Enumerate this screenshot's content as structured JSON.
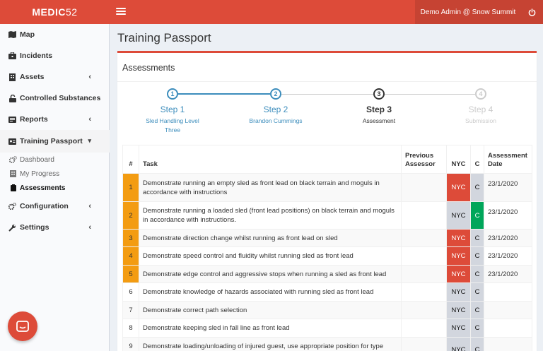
{
  "app": {
    "logo_bold": "MEDIC",
    "logo_light": "52",
    "user": "Demo Admin @ Snow Summit"
  },
  "sidebar": {
    "items": [
      {
        "label": "Map",
        "icon": "map-icon"
      },
      {
        "label": "Incidents",
        "icon": "briefcase-icon"
      },
      {
        "label": "Assets",
        "icon": "building-icon"
      },
      {
        "label": "Controlled Substances",
        "icon": "lock-icon"
      },
      {
        "label": "Reports",
        "icon": "report-icon"
      },
      {
        "label": "Training Passport",
        "icon": "passport-icon"
      },
      {
        "label": "Configuration",
        "icon": "gears-icon"
      },
      {
        "label": "Settings",
        "icon": "wrench-icon"
      }
    ],
    "sub_items": [
      {
        "label": "Dashboard",
        "icon": "gears-icon"
      },
      {
        "label": "My Progress",
        "icon": "building-icon"
      },
      {
        "label": "Assessments",
        "icon": "clipboard-icon"
      }
    ]
  },
  "page": {
    "title": "Training Passport"
  },
  "box": {
    "title": "Assessments"
  },
  "steps": [
    {
      "number": "1",
      "title": "Step 1",
      "sub1": "Sled Handling Level",
      "sub2": "Three",
      "state": "done"
    },
    {
      "number": "2",
      "title": "Step 2",
      "sub1": "Brandon Cummings",
      "sub2": "",
      "state": "done"
    },
    {
      "number": "3",
      "title": "Step 3",
      "sub1": "Assessment",
      "sub2": "",
      "state": "current"
    },
    {
      "number": "4",
      "title": "Step 4",
      "sub1": "Submission",
      "sub2": "",
      "state": "todo"
    }
  ],
  "table": {
    "headers": {
      "num": "#",
      "task": "Task",
      "prev1": "Previous",
      "prev2": "Assessor",
      "nyc": "NYC",
      "c": "C",
      "date1": "Assessment",
      "date2": "Date"
    },
    "rows": [
      {
        "num": "1",
        "task": "Demonstrate running an empty sled as front lead on black terrain and moguls in accordance with instructions",
        "nyc": "NYC",
        "c": "C",
        "date": "23/1/2020",
        "flag": true,
        "result": "nyc"
      },
      {
        "num": "2",
        "task": "Demonstrate running a loaded sled (front lead positions) on black terrain and moguls in accordance with instructions.",
        "nyc": "NYC",
        "c": "C",
        "date": "23/1/2020",
        "flag": true,
        "result": "c"
      },
      {
        "num": "3",
        "task": "Demonstrate direction change whilst running as front lead on sled",
        "nyc": "NYC",
        "c": "C",
        "date": "23/1/2020",
        "flag": true,
        "result": "nyc"
      },
      {
        "num": "4",
        "task": "Demonstrate speed control and fluidity whilst running sled as front lead",
        "nyc": "NYC",
        "c": "C",
        "date": "23/1/2020",
        "flag": true,
        "result": "nyc"
      },
      {
        "num": "5",
        "task": "Demonstrate edge control and aggressive stops when running a sled as front lead",
        "nyc": "NYC",
        "c": "C",
        "date": "23/1/2020",
        "flag": true,
        "result": "nyc"
      },
      {
        "num": "6",
        "task": "Demonstrate knowledge of hazards associated with running sled as front lead",
        "nyc": "NYC",
        "c": "C",
        "date": "",
        "flag": false,
        "result": ""
      },
      {
        "num": "7",
        "task": "Demonstrate correct path selection",
        "nyc": "NYC",
        "c": "C",
        "date": "",
        "flag": false,
        "result": ""
      },
      {
        "num": "8",
        "task": "Demonstrate keeping sled in fall line as front lead",
        "nyc": "NYC",
        "c": "C",
        "date": "",
        "flag": false,
        "result": ""
      },
      {
        "num": "9",
        "task": "Demonstrate loading/unloading of injured guest, use appropriate position for type",
        "nyc": "NYC",
        "c": "C",
        "date": "",
        "flag": false,
        "result": ""
      }
    ]
  },
  "colors": {
    "brand": "#dd4b39",
    "step_done": "#3c8dbc",
    "flag": "#f39c12",
    "green": "#00a65a",
    "grey": "#d2d6de"
  }
}
